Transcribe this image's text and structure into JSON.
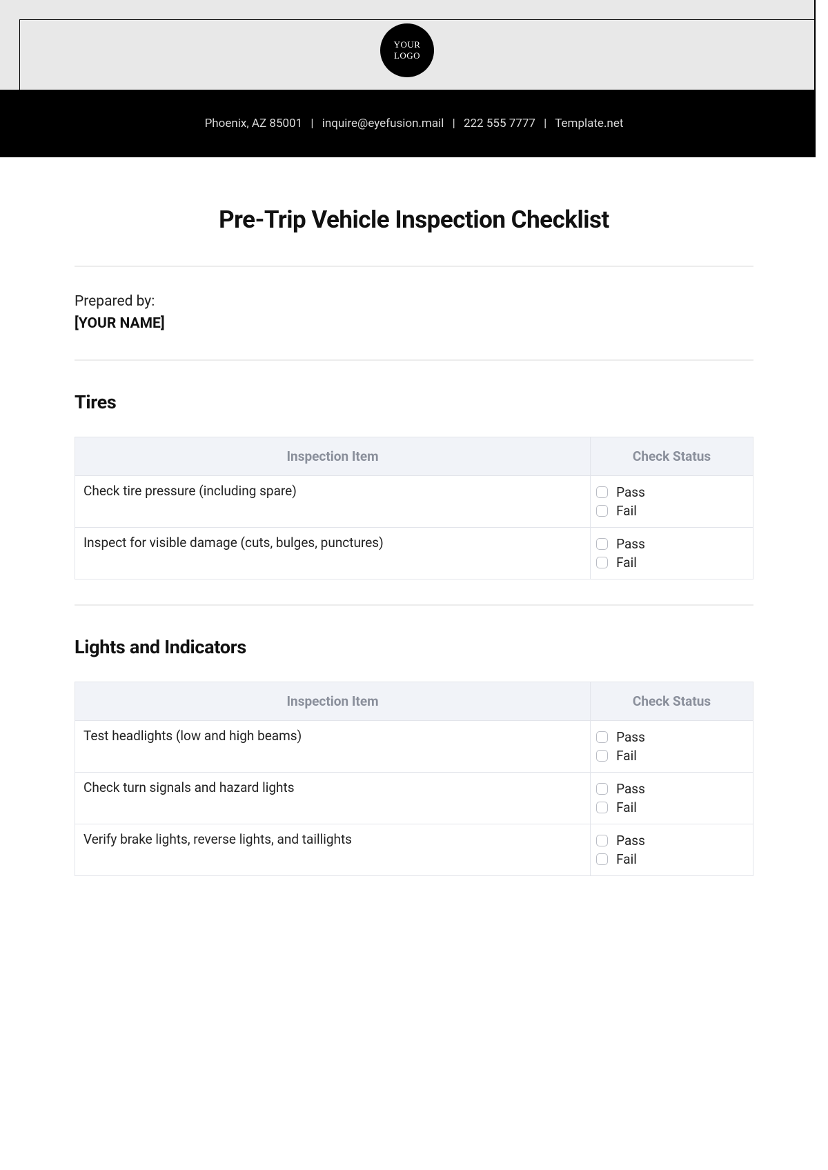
{
  "logo": {
    "line1": "YOUR",
    "line2": "LOGO"
  },
  "header": {
    "address": "Phoenix, AZ 85001",
    "email": "inquire@eyefusion.mail",
    "phone": "222 555 7777",
    "source": "Template.net"
  },
  "title": "Pre-Trip Vehicle Inspection Checklist",
  "prepared": {
    "label": "Prepared by:",
    "name": "[YOUR NAME]"
  },
  "columns": {
    "item": "Inspection Item",
    "status": "Check Status"
  },
  "statusOptions": {
    "pass": "Pass",
    "fail": "Fail"
  },
  "sections": [
    {
      "title": "Tires",
      "rows": [
        "Check tire pressure (including spare)",
        "Inspect for visible damage (cuts, bulges, punctures)"
      ]
    },
    {
      "title": "Lights and Indicators",
      "rows": [
        "Test headlights (low and high beams)",
        "Check turn signals and hazard lights",
        "Verify brake lights, reverse lights, and taillights"
      ]
    }
  ]
}
